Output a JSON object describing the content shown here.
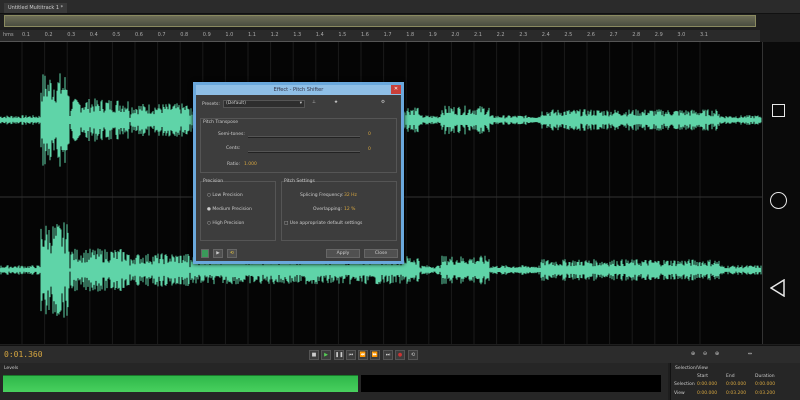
{
  "tab": {
    "label": "Untitled Multitrack 1 *"
  },
  "ruler": {
    "unit": "hms",
    "ticks": [
      "0.1",
      "0.2",
      "0.3",
      "0.4",
      "0.5",
      "0.6",
      "0.7",
      "0.8",
      "0.9",
      "1.0",
      "1.1",
      "1.2",
      "1.3",
      "1.4",
      "1.5",
      "1.6",
      "1.7",
      "1.8",
      "1.9",
      "2.0",
      "2.1",
      "2.2",
      "2.3",
      "2.4",
      "2.5",
      "2.6",
      "2.7",
      "2.8",
      "2.9",
      "3.0",
      "3.1"
    ]
  },
  "waveform": {
    "color": "#5fd4a8"
  },
  "dialog": {
    "title": "Effect - Pitch Shifter",
    "presets_label": "Presets:",
    "preset_value": "(Default)",
    "pitch_transpose": "Pitch Transpose",
    "semitones_label": "Semi-tones:",
    "semitones_value": "0",
    "cents_label": "Cents:",
    "cents_value": "0",
    "ratio_label": "Ratio:",
    "ratio_value": "1.000",
    "precision_title": "Precision",
    "precision_options": [
      "Low Precision",
      "Medium Precision",
      "High Precision"
    ],
    "precision_selected": "Medium Precision",
    "pitch_settings_title": "Pitch Settings",
    "splicing_label": "Splicing Frequency:",
    "splicing_value": "32 Hz",
    "overlap_label": "Overlapping:",
    "overlap_value": "12 %",
    "default_settings_label": "Use appropriate default settings",
    "apply_label": "Apply",
    "close_label": "Close"
  },
  "transport": {
    "time": "0:01.360"
  },
  "levels": {
    "title": "Levels",
    "fill_fraction": 0.54,
    "color": "#3cc454"
  },
  "selection": {
    "title": "Selection/View",
    "headers": [
      "Start",
      "End",
      "Duration"
    ],
    "rows": [
      {
        "label": "Selection",
        "values": [
          "0:00.000",
          "0:00.000",
          "0:00.000"
        ]
      },
      {
        "label": "View",
        "values": [
          "0:00.000",
          "0:03.200",
          "0:03.200"
        ]
      }
    ]
  }
}
